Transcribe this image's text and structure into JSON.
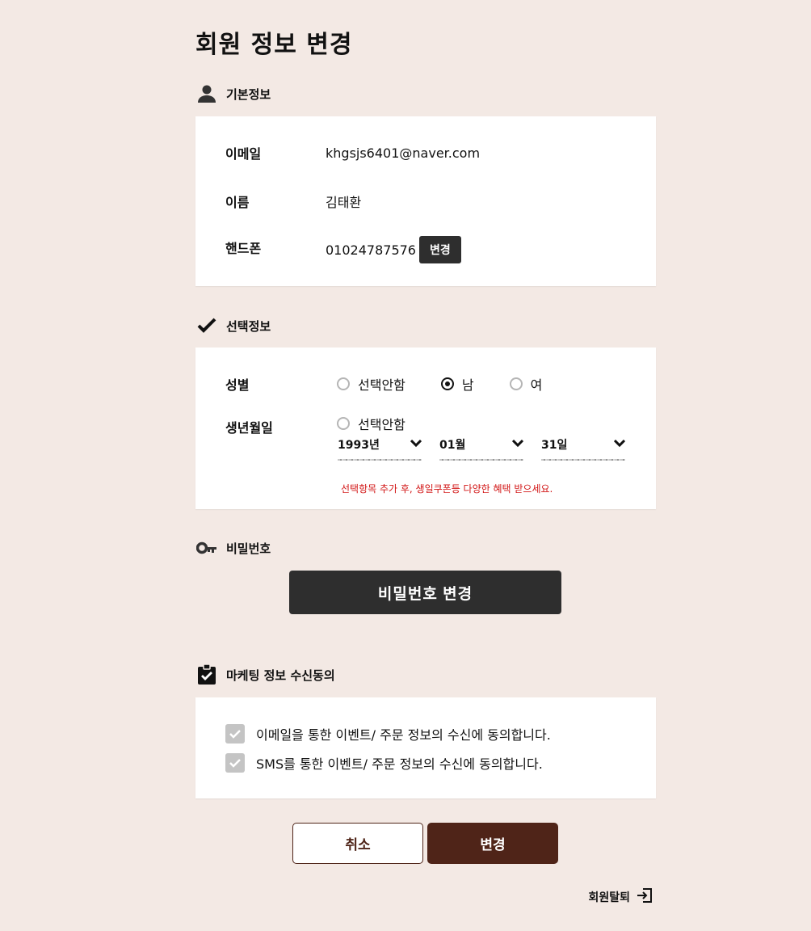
{
  "page": {
    "title": "회원 정보 변경"
  },
  "basic": {
    "heading": "기본정보",
    "icon": "user-icon",
    "email_label": "이메일",
    "email_value": "khgsjs6401@naver.com",
    "name_label": "이름",
    "name_value": "김태환",
    "phone_label": "핸드폰",
    "phone_value": "01024787576",
    "phone_change_label": "변경"
  },
  "optional": {
    "heading": "선택정보",
    "icon": "check-icon",
    "gender_label": "성별",
    "gender_options": [
      "선택안함",
      "남",
      "여"
    ],
    "gender_selected": "남",
    "birth_label": "생년월일",
    "birth_none_label": "선택안함",
    "birth_year": "1993년",
    "birth_month": "01월",
    "birth_day": "31일",
    "notice": "선택항목 추가 후, 생일쿠폰등 다양한 혜택 받으세요."
  },
  "password": {
    "heading": "비밀번호",
    "icon": "key-icon",
    "change_button": "비밀번호 변경"
  },
  "marketing": {
    "heading": "마케팅 정보 수신동의",
    "icon": "clipboard-check-icon",
    "email_consent": "이메일을 통한 이벤트/ 주문 정보의 수신에 동의합니다.",
    "sms_consent": "SMS를 통한 이벤트/ 주문 정보의 수신에 동의합니다."
  },
  "actions": {
    "cancel_label": "취소",
    "submit_label": "변경",
    "withdraw_label": "회원탈퇴",
    "withdraw_icon": "sign-out-icon"
  },
  "colors": {
    "background": "#f3e9e4",
    "primary_brown": "#4f2418",
    "dark_button": "#2e2e2e",
    "notice_red": "#d21616"
  }
}
